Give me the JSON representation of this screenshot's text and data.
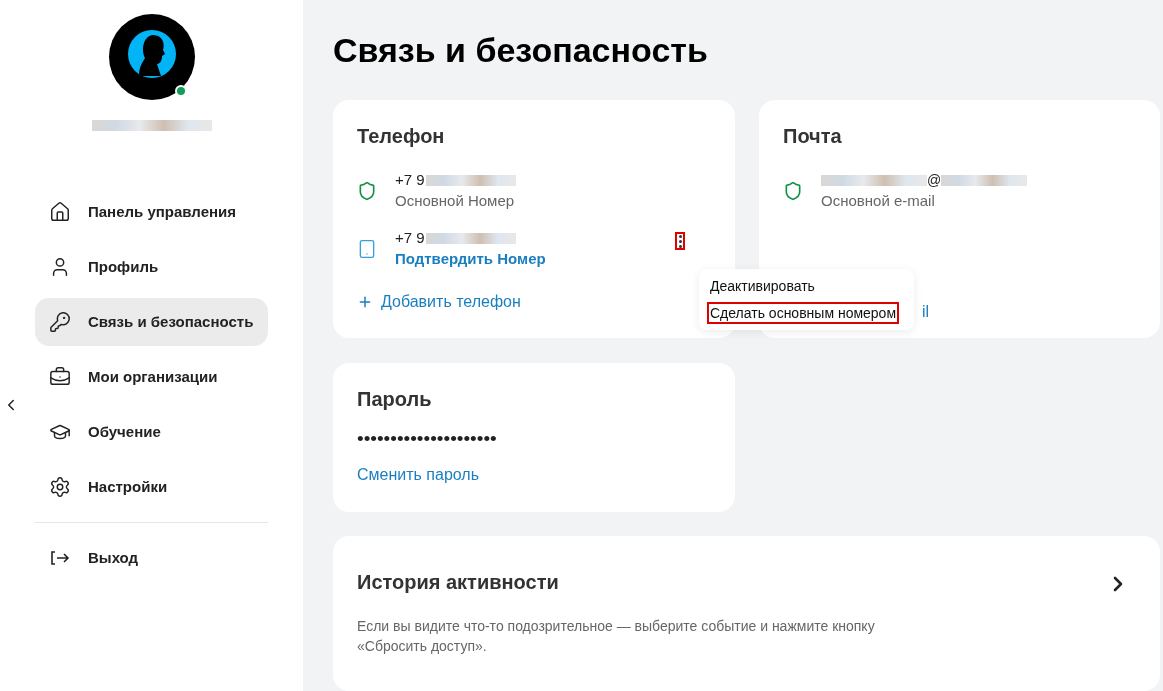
{
  "sidebar": {
    "user": {
      "online": true
    },
    "items": [
      {
        "label": "Панель управления",
        "selected": false
      },
      {
        "label": "Профиль",
        "selected": false
      },
      {
        "label": "Связь и безопасность",
        "selected": true
      },
      {
        "label": "Мои организации",
        "selected": false
      },
      {
        "label": "Обучение",
        "selected": false
      },
      {
        "label": "Настройки",
        "selected": false
      }
    ],
    "logout": {
      "label": "Выход"
    }
  },
  "page_title": "Связь и безопасность",
  "phone_card": {
    "title": "Телефон",
    "phones": [
      {
        "prefix": "+7 9",
        "caption": "Основной Номер",
        "kind": "primary"
      },
      {
        "prefix": "+7 9",
        "caption": "Подтвердить Номер",
        "kind": "unconfirmed",
        "menu_highlighted": true
      }
    ],
    "add_link": "Добавить телефон"
  },
  "context_menu": {
    "items": [
      {
        "label": "Деактивировать",
        "highlighted": false
      },
      {
        "label": "Сделать основным номером",
        "highlighted": true
      }
    ]
  },
  "mail_card": {
    "title": "Почта",
    "email_at": "@",
    "caption": "Основной e-mail",
    "add_link_visible": "il"
  },
  "password_card": {
    "title": "Пароль",
    "mask": "•••••••••••••••••••••",
    "link": "Сменить пароль"
  },
  "history_card": {
    "title": "История активности",
    "text": "Если вы видите что-то подозрительное — выберите событие и нажмите кнопку «Сбросить доступ»."
  }
}
